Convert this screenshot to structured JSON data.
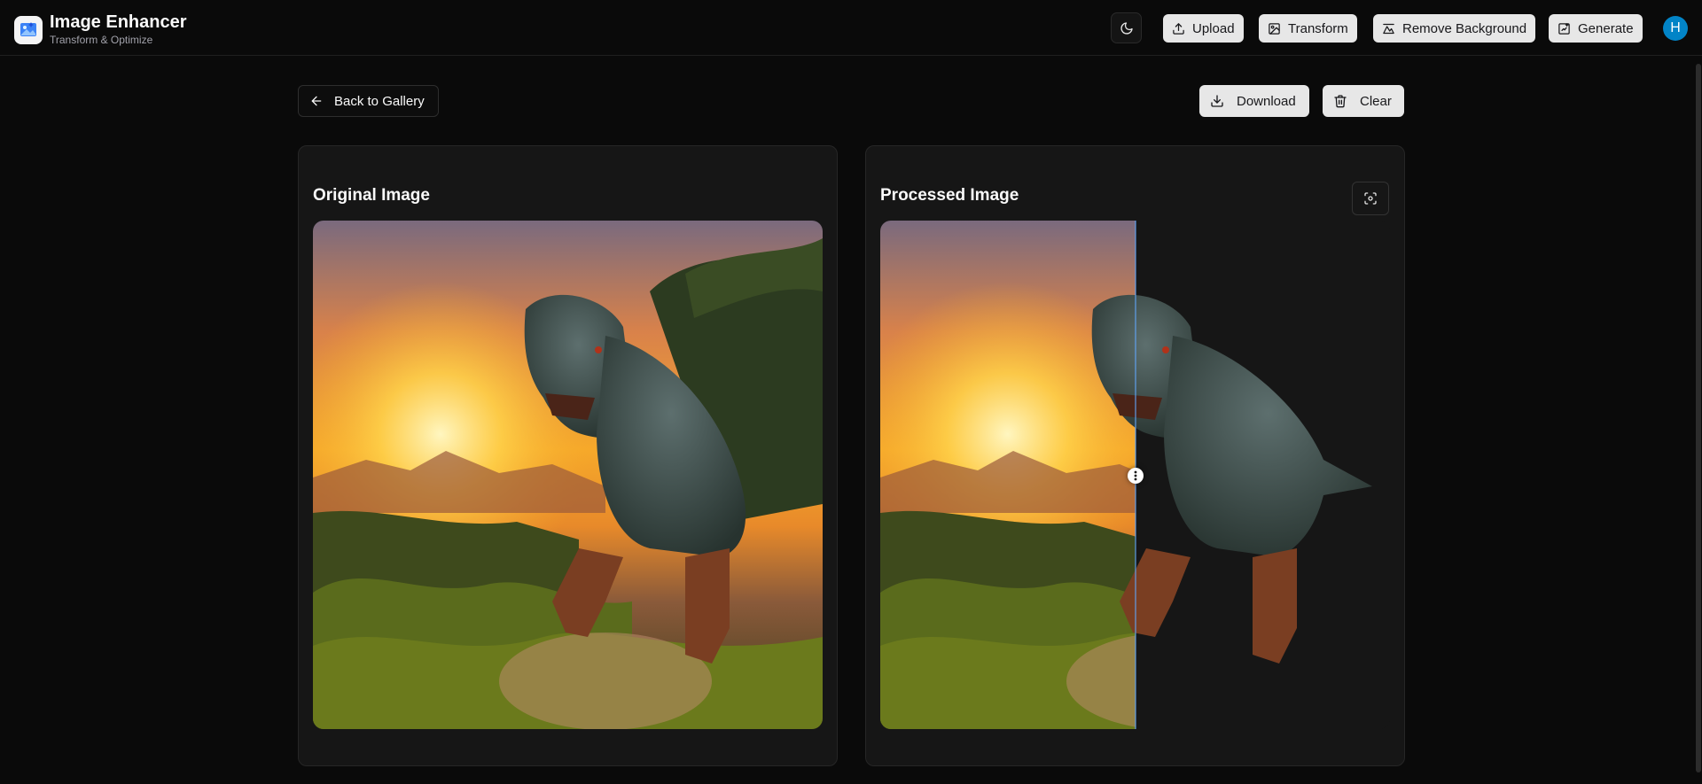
{
  "app": {
    "title": "Image Enhancer",
    "subtitle": "Transform & Optimize",
    "avatar_initial": "H"
  },
  "header": {
    "theme_icon": "moon-icon",
    "nav": [
      {
        "label": "Upload",
        "icon": "upload-icon"
      },
      {
        "label": "Transform",
        "icon": "transform-icon"
      },
      {
        "label": "Remove Background",
        "icon": "remove-background-icon"
      },
      {
        "label": "Generate",
        "icon": "generate-icon"
      }
    ]
  },
  "actions": {
    "back_label": "Back to Gallery",
    "download_label": "Download",
    "clear_label": "Clear"
  },
  "panels": {
    "original_title": "Original Image",
    "processed_title": "Processed Image"
  },
  "comparison": {
    "slider_position": 0.5
  },
  "colors": {
    "background": "#0a0a0a",
    "card": "#161616",
    "button_light": "#e7e7e7",
    "avatar": "#0284c7",
    "divider": "#60a5fa"
  }
}
